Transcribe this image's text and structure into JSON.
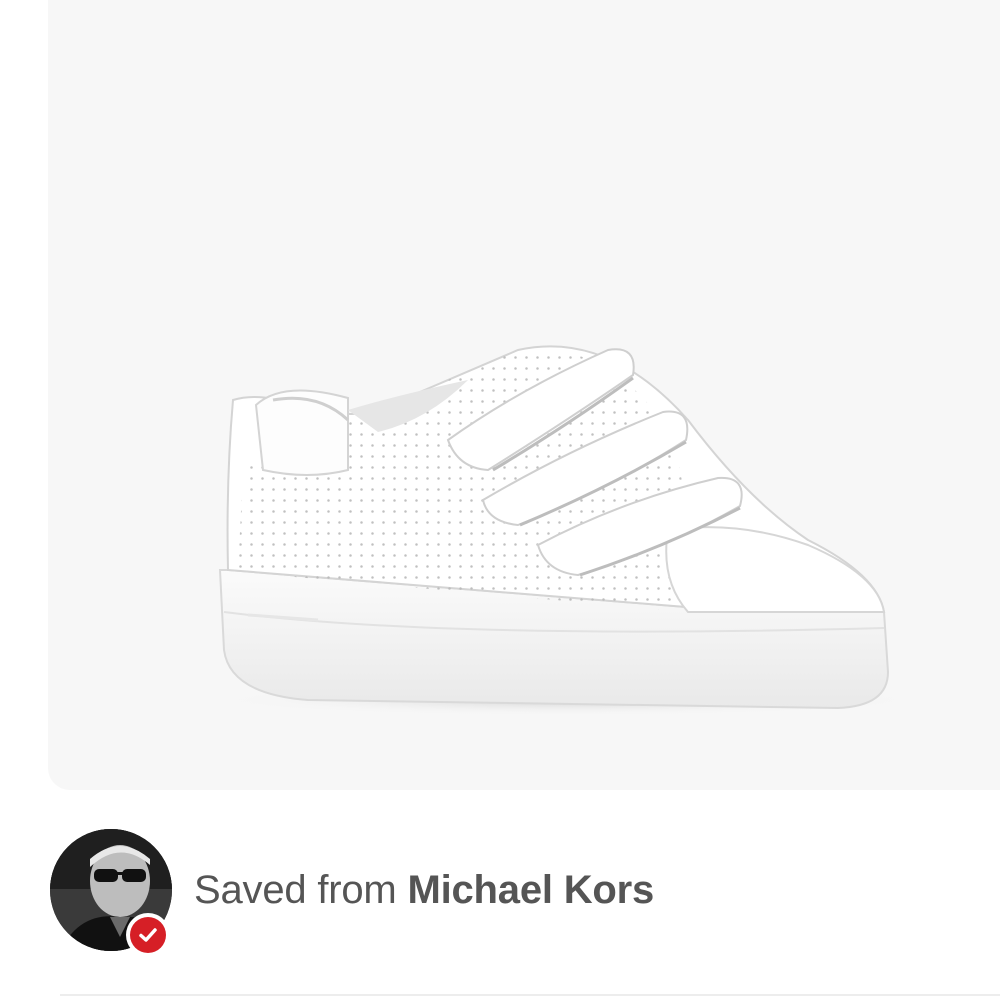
{
  "pin": {
    "image_alt": "White perforated leather sneaker with three hook-and-loop straps",
    "background_color": "#f7f7f7"
  },
  "attribution": {
    "prefix": "Saved from",
    "source_name": "Michael Kors",
    "avatar_icon": "avatar-icon",
    "verified_icon": "verified-check-icon",
    "badge_color": "#d61f26"
  }
}
